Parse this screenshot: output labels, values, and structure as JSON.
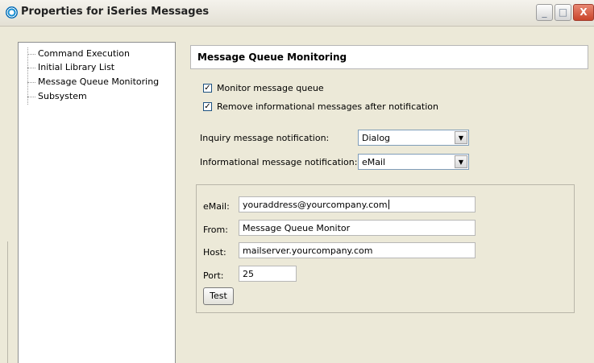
{
  "window": {
    "title": "Properties for iSeries Messages",
    "controls": {
      "minimize": "_",
      "maximize": "□",
      "close": "X"
    }
  },
  "tree": {
    "items": [
      {
        "label": "Command Execution"
      },
      {
        "label": "Initial Library List"
      },
      {
        "label": "Message Queue Monitoring",
        "selected": true
      },
      {
        "label": "Subsystem"
      }
    ]
  },
  "section": {
    "title": "Message Queue Monitoring"
  },
  "options": {
    "monitor_queue": {
      "label": "Monitor message queue",
      "checked": true,
      "mark": "✓"
    },
    "remove_info": {
      "label": "Remove informational messages after notification",
      "checked": true,
      "mark": "✓"
    }
  },
  "notifications": {
    "inquiry": {
      "label": "Inquiry message notification:",
      "value": "Dialog"
    },
    "informational": {
      "label": "Informational message notification:",
      "value": "eMail"
    }
  },
  "email_settings": {
    "email": {
      "label": "eMail:",
      "value": "youraddress@yourcompany.com"
    },
    "from": {
      "label": "From:",
      "value": "Message Queue Monitor"
    },
    "host": {
      "label": "Host:",
      "value": "mailserver.yourcompany.com"
    },
    "port": {
      "label": "Port:",
      "value": "25"
    },
    "test_button": "Test"
  },
  "icons": {
    "dropdown_arrow": "▼",
    "app_icon": "app-icon"
  }
}
